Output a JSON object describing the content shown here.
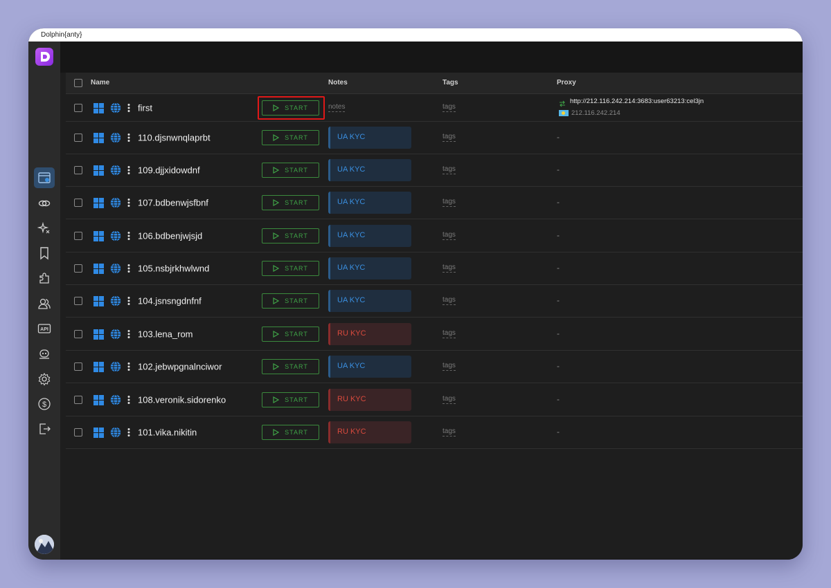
{
  "app": {
    "title": "Dolphin{anty}"
  },
  "table": {
    "headers": {
      "name": "Name",
      "notes": "Notes",
      "tags": "Tags",
      "proxy": "Proxy"
    },
    "start_label": "START",
    "rows": [
      {
        "name": "first",
        "note": "notes",
        "note_type": "plain",
        "tags": "tags",
        "proxy_url": "http://212.116.242.214:3683:user63213:cel3jn",
        "proxy_ip": "212.116.242.214"
      },
      {
        "name": "110.djsnwnqlaprbt",
        "note": "UA KYC",
        "note_type": "ua",
        "tags": "tags",
        "proxy": "-"
      },
      {
        "name": "109.djjxidowdnf",
        "note": "UA KYC",
        "note_type": "ua",
        "tags": "tags",
        "proxy": "-"
      },
      {
        "name": "107.bdbenwjsfbnf",
        "note": "UA KYC",
        "note_type": "ua",
        "tags": "tags",
        "proxy": "-"
      },
      {
        "name": "106.bdbenjwjsjd",
        "note": "UA KYC",
        "note_type": "ua",
        "tags": "tags",
        "proxy": "-"
      },
      {
        "name": "105.nsbjrkhwlwnd",
        "note": "UA KYC",
        "note_type": "ua",
        "tags": "tags",
        "proxy": "-"
      },
      {
        "name": "104.jsnsngdnfnf",
        "note": "UA KYC",
        "note_type": "ua",
        "tags": "tags",
        "proxy": "-"
      },
      {
        "name": "103.lena_rom",
        "note": "RU KYC",
        "note_type": "ru",
        "tags": "tags",
        "proxy": "-"
      },
      {
        "name": "102.jebwpgnalnciwor",
        "note": "UA KYC",
        "note_type": "ua",
        "tags": "tags",
        "proxy": "-"
      },
      {
        "name": "108.veronik.sidorenko",
        "note": "RU KYC",
        "note_type": "ru",
        "tags": "tags",
        "proxy": "-"
      },
      {
        "name": "101.vika.nikitin",
        "note": "RU KYC",
        "note_type": "ru",
        "tags": "tags",
        "proxy": "-"
      }
    ]
  },
  "sidebar": {
    "items": [
      {
        "icon": "browser-profiles-icon",
        "active": true
      },
      {
        "icon": "link-icon"
      },
      {
        "icon": "sparkle-icon"
      },
      {
        "icon": "bookmark-icon"
      },
      {
        "icon": "puzzle-icon"
      },
      {
        "icon": "users-icon"
      },
      {
        "icon": "api-icon",
        "label": "API"
      },
      {
        "icon": "robot-icon"
      },
      {
        "icon": "gear-icon"
      },
      {
        "icon": "dollar-icon"
      },
      {
        "icon": "logout-icon"
      }
    ]
  },
  "colors": {
    "start_green": "#3fa247",
    "ua_blue": "#3a8fe0",
    "ru_red": "#d94a3d",
    "highlight": "#e01818"
  }
}
